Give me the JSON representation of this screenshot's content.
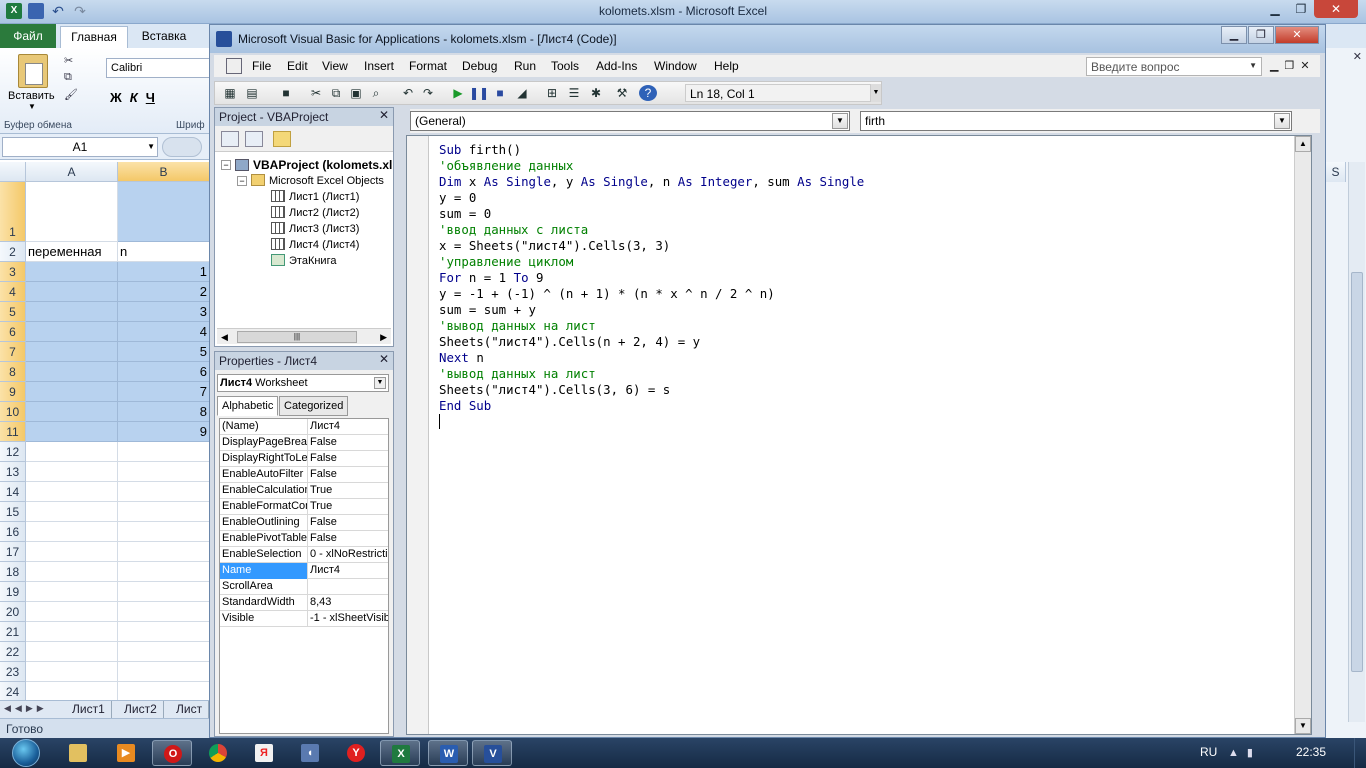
{
  "excel": {
    "title": "kolomets.xlsm  -  Microsoft Excel",
    "tabs": {
      "file": "Файл",
      "home": "Главная",
      "insert": "Вставка"
    },
    "ribbon": {
      "paste_label": "Вставить",
      "font_name": "Calibri",
      "bold": "Ж",
      "italic": "К",
      "underline": "Ч",
      "group_clipboard": "Буфер обмена",
      "group_font": "Шриф"
    },
    "name_box": "A1",
    "columns": [
      "A",
      "B"
    ],
    "right_col": "S",
    "rows": [
      "1",
      "2",
      "3",
      "4",
      "5",
      "6",
      "7",
      "8",
      "9",
      "10",
      "11",
      "12",
      "13",
      "14",
      "15",
      "16",
      "17",
      "18",
      "19",
      "20",
      "21",
      "22",
      "23",
      "24"
    ],
    "cells": {
      "a2": "переменная",
      "b2": "n",
      "b_values": [
        "1",
        "2",
        "3",
        "4",
        "5",
        "6",
        "7",
        "8",
        "9"
      ]
    },
    "sheet_tabs": [
      "Лист1",
      "Лист2",
      "Лист"
    ],
    "status": "Готово"
  },
  "vba": {
    "title": "Microsoft Visual Basic for Applications - kolomets.xlsm - [Лист4 (Code)]",
    "menu": [
      "File",
      "Edit",
      "View",
      "Insert",
      "Format",
      "Debug",
      "Run",
      "Tools",
      "Add-Ins",
      "Window",
      "Help"
    ],
    "ask_placeholder": "Введите вопрос",
    "status_position": "Ln 18, Col 1",
    "project": {
      "header": "Project - VBAProject",
      "root": "VBAProject (kolomets.xl",
      "folder": "Microsoft Excel Objects",
      "items": [
        "Лист1 (Лист1)",
        "Лист2 (Лист2)",
        "Лист3 (Лист3)",
        "Лист4 (Лист4)",
        "ЭтаКнига"
      ]
    },
    "properties": {
      "header": "Properties - Лист4",
      "object_name": "Лист4",
      "object_type": "Worksheet",
      "tabs": [
        "Alphabetic",
        "Categorized"
      ],
      "rows": [
        {
          "name": "(Name)",
          "value": "Лист4"
        },
        {
          "name": "DisplayPageBreak",
          "value": "False"
        },
        {
          "name": "DisplayRightToLef",
          "value": "False"
        },
        {
          "name": "EnableAutoFilter",
          "value": "False"
        },
        {
          "name": "EnableCalculation",
          "value": "True"
        },
        {
          "name": "EnableFormatCon",
          "value": "True"
        },
        {
          "name": "EnableOutlining",
          "value": "False"
        },
        {
          "name": "EnablePivotTable",
          "value": "False"
        },
        {
          "name": "EnableSelection",
          "value": "0 - xlNoRestrictio"
        },
        {
          "name": "Name",
          "value": "Лист4",
          "selected": true
        },
        {
          "name": "ScrollArea",
          "value": ""
        },
        {
          "name": "StandardWidth",
          "value": "8,43"
        },
        {
          "name": "Visible",
          "value": "-1 - xlSheetVisib"
        }
      ]
    },
    "code": {
      "object_combo": "(General)",
      "proc_combo": "firth",
      "lines": [
        [
          {
            "t": "kw",
            "s": "Sub "
          },
          {
            "t": "tx",
            "s": "firth()"
          }
        ],
        [
          {
            "t": "cm",
            "s": "'объявление данных"
          }
        ],
        [
          {
            "t": "kw",
            "s": "Dim "
          },
          {
            "t": "tx",
            "s": "x "
          },
          {
            "t": "kw",
            "s": "As Single"
          },
          {
            "t": "tx",
            "s": ", y "
          },
          {
            "t": "kw",
            "s": "As Single"
          },
          {
            "t": "tx",
            "s": ", n "
          },
          {
            "t": "kw",
            "s": "As Integer"
          },
          {
            "t": "tx",
            "s": ", sum "
          },
          {
            "t": "kw",
            "s": "As Single"
          }
        ],
        [
          {
            "t": "tx",
            "s": "y = 0"
          }
        ],
        [
          {
            "t": "tx",
            "s": "sum = 0"
          }
        ],
        [
          {
            "t": "cm",
            "s": "'ввод данных с листа"
          }
        ],
        [
          {
            "t": "tx",
            "s": "x = Sheets(\"лист4\").Cells(3, 3)"
          }
        ],
        [
          {
            "t": "cm",
            "s": "'управление циклом"
          }
        ],
        [
          {
            "t": "kw",
            "s": "For "
          },
          {
            "t": "tx",
            "s": "n = 1 "
          },
          {
            "t": "kw",
            "s": "To "
          },
          {
            "t": "tx",
            "s": "9"
          }
        ],
        [
          {
            "t": "tx",
            "s": "y = -1 + (-1) ^ (n + 1) * (n * x ^ n / 2 ^ n)"
          }
        ],
        [
          {
            "t": "tx",
            "s": "sum = sum + y"
          }
        ],
        [
          {
            "t": "cm",
            "s": "'вывод данных на лист"
          }
        ],
        [
          {
            "t": "tx",
            "s": "Sheets(\"лист4\").Cells(n + 2, 4) = y"
          }
        ],
        [
          {
            "t": "kw",
            "s": "Next "
          },
          {
            "t": "tx",
            "s": "n"
          }
        ],
        [
          {
            "t": "cm",
            "s": "'вывод данных на лист"
          }
        ],
        [
          {
            "t": "tx",
            "s": "Sheets(\"лист4\").Cells(3, 6) = s"
          }
        ],
        [
          {
            "t": "kw",
            "s": "End Sub"
          }
        ]
      ]
    }
  },
  "taskbar": {
    "language": "RU",
    "clock": "22:35",
    "apps": [
      "explorer-icon",
      "media-player-icon",
      "opera-icon",
      "chrome-icon",
      "yandex-icon",
      "audio-icon",
      "yandex-browser-icon",
      "excel-icon",
      "word-icon",
      "vba-icon"
    ]
  }
}
